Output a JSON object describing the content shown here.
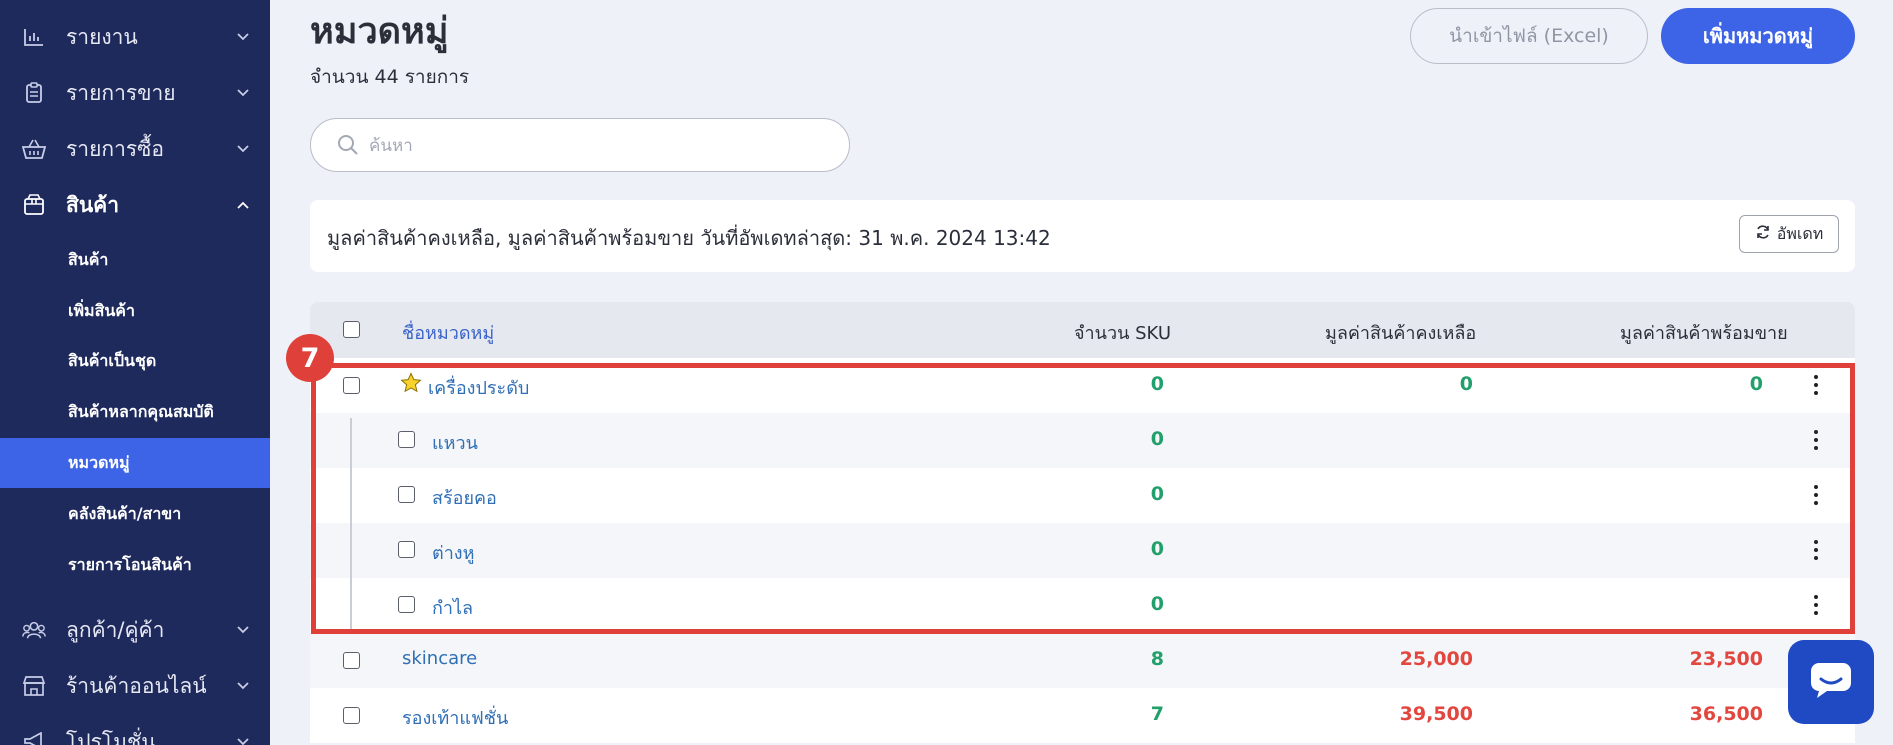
{
  "sidebar": {
    "items": [
      {
        "label": "รายงาน",
        "icon": "bar-chart-icon"
      },
      {
        "label": "รายการขาย",
        "icon": "clipboard-icon"
      },
      {
        "label": "รายการซื้อ",
        "icon": "basket-icon"
      },
      {
        "label": "สินค้า",
        "icon": "box-icon"
      },
      {
        "label": "ลูกค้า/คู่ค้า",
        "icon": "users-icon"
      },
      {
        "label": "ร้านค้าออนไลน์",
        "icon": "store-icon"
      },
      {
        "label": "โปรโมชั่น",
        "icon": "megaphone-icon"
      }
    ],
    "subitems": [
      {
        "label": "สินค้า"
      },
      {
        "label": "เพิ่มสินค้า"
      },
      {
        "label": "สินค้าเป็นชุด"
      },
      {
        "label": "สินค้าหลากคุณสมบัติ"
      },
      {
        "label": "หมวดหมู่"
      },
      {
        "label": "คลังสินค้า/สาขา"
      },
      {
        "label": "รายการโอนสินค้า"
      }
    ],
    "active_subitem": "หมวดหมู่"
  },
  "header": {
    "title": "หมวดหมู่",
    "count_text": "จำนวน 44 รายการ",
    "import_button": "นำเข้าไฟล์ (Excel)",
    "add_button": "เพิ่มหมวดหมู่"
  },
  "search": {
    "placeholder": "ค้นหา",
    "value": ""
  },
  "info_bar": {
    "text": "มูลค่าสินค้าคงเหลือ, มูลค่าสินค้าพร้อมขาย วันที่อัพเดทล่าสุด: 31 พ.ค. 2024 13:42",
    "update_button": "อัพเดท"
  },
  "table": {
    "columns": [
      "ชื่อหมวดหมู่",
      "จำนวน SKU",
      "มูลค่าสินค้าคงเหลือ",
      "มูลค่าสินค้าพร้อมขาย"
    ],
    "rows": [
      {
        "name": "เครื่องประดับ",
        "sku": "0",
        "stock_value": "0",
        "ready_value": "0",
        "starred": true,
        "child": false
      },
      {
        "name": "แหวน",
        "sku": "0",
        "stock_value": "",
        "ready_value": "",
        "child": true
      },
      {
        "name": "สร้อยคอ",
        "sku": "0",
        "stock_value": "",
        "ready_value": "",
        "child": true
      },
      {
        "name": "ต่างหู",
        "sku": "0",
        "stock_value": "",
        "ready_value": "",
        "child": true
      },
      {
        "name": "กำไล",
        "sku": "0",
        "stock_value": "",
        "ready_value": "",
        "child": true
      },
      {
        "name": "skincare",
        "sku": "8",
        "stock_value": "25,000",
        "ready_value": "23,500",
        "child": false
      },
      {
        "name": "รองเท้าแฟชั่น",
        "sku": "7",
        "stock_value": "39,500",
        "ready_value": "36,500",
        "child": false
      }
    ]
  },
  "annotation": {
    "step_number": "7"
  },
  "colors": {
    "sidebar_bg": "#1f2a5c",
    "accent": "#3d63e6",
    "highlight": "#e0403a",
    "positive": "#22a06b",
    "value_red": "#e2473f"
  }
}
